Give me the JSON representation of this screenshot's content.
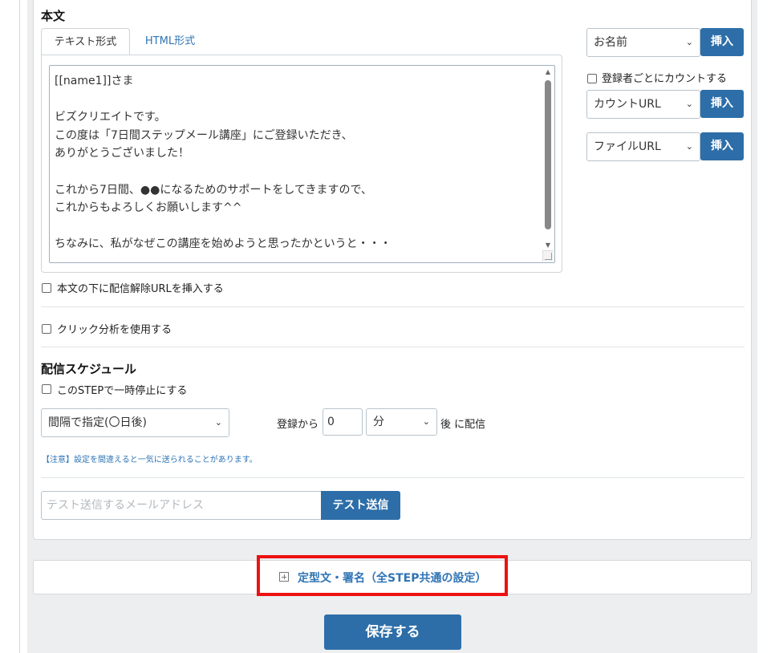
{
  "body_section": {
    "title": "本文",
    "tabs": [
      {
        "label": "テキスト形式",
        "active": true
      },
      {
        "label": "HTML形式",
        "active": false
      }
    ],
    "body_text": "[[name1]]さま\n\nビズクリエイトです。\nこの度は「7日間ステップメール講座」にご登録いただき、\nありがとうございました！\n\nこれから7日間、●●になるためのサポートをしてきますので、\nこれからもよろしくお願いします^^\n\nちなみに、私がなぜこの講座を始めようと思ったかというと・・・"
  },
  "insert_panel": {
    "field_select": "お名前",
    "insert_label": "挿入",
    "count_checkbox_label": "登録者ごとにカウントする",
    "count_url_select": "カウントURL",
    "file_url_select": "ファイルURL"
  },
  "options": {
    "unsubscribe_label": "本文の下に配信解除URLを挿入する",
    "click_analysis_label": "クリック分析を使用する"
  },
  "schedule": {
    "title": "配信スケジュール",
    "pause_label": "このSTEPで一時停止にする",
    "mode_select": "間隔で指定(〇日後)",
    "from_label": "登録から",
    "value": "0",
    "unit_select": "分",
    "after_label": "後 に配信",
    "note": "【注意】設定を間違えると一気に送られることがあります。"
  },
  "test_send": {
    "placeholder": "テスト送信するメールアドレス",
    "button_label": "テスト送信"
  },
  "template_section": {
    "label": "定型文・署名（全STEP共通の設定）"
  },
  "save_label": "保存する",
  "colors": {
    "accent": "#2d6ea8",
    "link": "#2f74b5",
    "highlight": "#ee1111"
  }
}
